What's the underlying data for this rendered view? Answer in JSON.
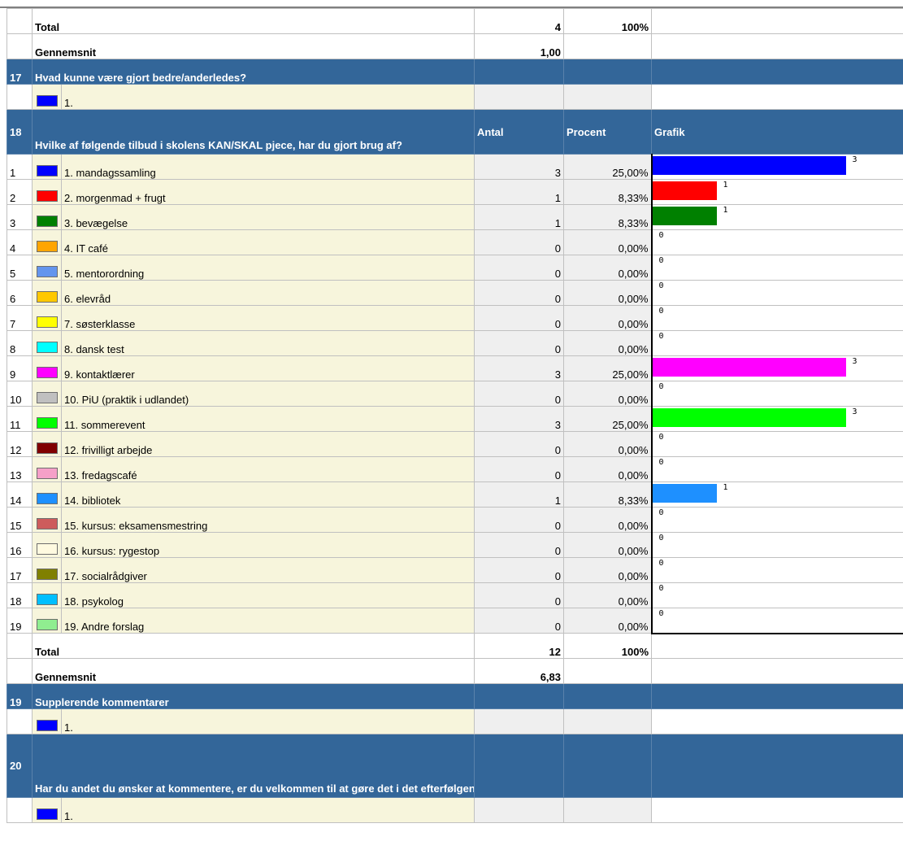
{
  "q17": {
    "prev_total_label": "Total",
    "prev_total_count": "4",
    "prev_total_pct": "100%",
    "prev_avg_label": "Gennemsnit",
    "prev_avg_value": "1,00",
    "number": "17",
    "title": "Hvad kunne være gjort bedre/anderledes?",
    "answer_label": "1.",
    "answer_color": "#0000ff"
  },
  "q18": {
    "number": "18",
    "title": "Hvilke af følgende tilbud i skolens KAN/SKAL pjece, har du gjort brug af?",
    "col_count": "Antal",
    "col_pct": "Procent",
    "col_graph": "Grafik",
    "rows": [
      {
        "num": "1",
        "label": "1. mandagssamling",
        "count": "3",
        "pct": "25,00%",
        "color": "#0000ff",
        "value": 3
      },
      {
        "num": "2",
        "label": "2. morgenmad + frugt",
        "count": "1",
        "pct": "8,33%",
        "color": "#ff0000",
        "value": 1
      },
      {
        "num": "3",
        "label": "3. bevægelse",
        "count": "1",
        "pct": "8,33%",
        "color": "#008000",
        "value": 1
      },
      {
        "num": "4",
        "label": "4. IT café",
        "count": "0",
        "pct": "0,00%",
        "color": "#ffa500",
        "value": 0
      },
      {
        "num": "5",
        "label": "5. mentorordning",
        "count": "0",
        "pct": "0,00%",
        "color": "#6495ed",
        "value": 0
      },
      {
        "num": "6",
        "label": "6. elevråd",
        "count": "0",
        "pct": "0,00%",
        "color": "#ffc800",
        "value": 0
      },
      {
        "num": "7",
        "label": "7. søsterklasse",
        "count": "0",
        "pct": "0,00%",
        "color": "#ffff00",
        "value": 0
      },
      {
        "num": "8",
        "label": "8. dansk test",
        "count": "0",
        "pct": "0,00%",
        "color": "#00ffff",
        "value": 0
      },
      {
        "num": "9",
        "label": "9. kontaktlærer",
        "count": "3",
        "pct": "25,00%",
        "color": "#ff00ff",
        "value": 3
      },
      {
        "num": "10",
        "label": "10. PiU (praktik i udlandet)",
        "count": "0",
        "pct": "0,00%",
        "color": "#c0c0c0",
        "value": 0
      },
      {
        "num": "11",
        "label": "11. sommerevent",
        "count": "3",
        "pct": "25,00%",
        "color": "#00ff00",
        "value": 3
      },
      {
        "num": "12",
        "label": "12. frivilligt arbejde",
        "count": "0",
        "pct": "0,00%",
        "color": "#800000",
        "value": 0
      },
      {
        "num": "13",
        "label": "13. fredagscafé",
        "count": "0",
        "pct": "0,00%",
        "color": "#f5a0c8",
        "value": 0
      },
      {
        "num": "14",
        "label": "14. bibliotek",
        "count": "1",
        "pct": "8,33%",
        "color": "#1e90ff",
        "value": 1
      },
      {
        "num": "15",
        "label": "15. kursus: eksamensmestring",
        "count": "0",
        "pct": "0,00%",
        "color": "#cd5c5c",
        "value": 0
      },
      {
        "num": "16",
        "label": "16. kursus: rygestop",
        "count": "0",
        "pct": "0,00%",
        "color": "#fffae0",
        "value": 0
      },
      {
        "num": "17",
        "label": "17. socialrådgiver",
        "count": "0",
        "pct": "0,00%",
        "color": "#808000",
        "value": 0
      },
      {
        "num": "18",
        "label": "18. psykolog",
        "count": "0",
        "pct": "0,00%",
        "color": "#00bfff",
        "value": 0
      },
      {
        "num": "19",
        "label": "19. Andre forslag",
        "count": "0",
        "pct": "0,00%",
        "color": "#90ee90",
        "value": 0
      }
    ],
    "total_label": "Total",
    "total_count": "12",
    "total_pct": "100%",
    "avg_label": "Gennemsnit",
    "avg_value": "6,83"
  },
  "q19": {
    "number": "19",
    "title": "Supplerende kommentarer",
    "answer_label": "1.",
    "answer_color": "#0000ff"
  },
  "q20": {
    "number": "20",
    "title": "Har du andet du ønsker at kommentere, er du velkommen til at gøre det i det efterfølgende felt:--Bemærk venligst at når du trykker på \"Send evalueringsskemaet\", kan du ikke mere ændre indholdet.",
    "answer_label": "1.",
    "answer_color": "#0000ff"
  }
}
